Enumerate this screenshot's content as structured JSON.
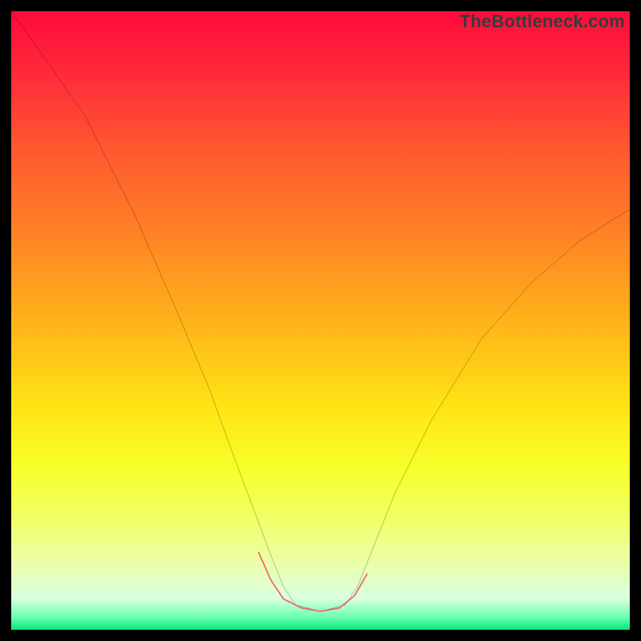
{
  "watermark_text": "TheBottleneck.com",
  "chart_data": {
    "type": "line",
    "title": "",
    "xlabel": "",
    "ylabel": "",
    "xlim": [
      0,
      100
    ],
    "ylim": [
      0,
      100
    ],
    "grid": false,
    "legend": false,
    "axes_visible": false,
    "background_gradient": {
      "direction": "top-to-bottom",
      "stops": [
        {
          "pos": 0,
          "color": "#ff0a3a"
        },
        {
          "pos": 10,
          "color": "#ff2a3a"
        },
        {
          "pos": 22,
          "color": "#ff5730"
        },
        {
          "pos": 36,
          "color": "#ff8225"
        },
        {
          "pos": 50,
          "color": "#ffb21a"
        },
        {
          "pos": 64,
          "color": "#ffe414"
        },
        {
          "pos": 74,
          "color": "#f7ff2a"
        },
        {
          "pos": 82,
          "color": "#f2ff66"
        },
        {
          "pos": 90,
          "color": "#e9ffb0"
        },
        {
          "pos": 95,
          "color": "#d8ffdf"
        },
        {
          "pos": 98,
          "color": "#6bffb0"
        },
        {
          "pos": 100,
          "color": "#00e87a"
        }
      ]
    },
    "series": [
      {
        "name": "bottleneck-curve",
        "color": "#000000",
        "width": 2,
        "x": [
          0,
          5,
          12,
          20,
          27,
          32,
          36,
          39,
          42,
          44,
          46,
          50,
          54,
          56,
          58,
          62,
          68,
          76,
          84,
          92,
          100
        ],
        "y": [
          100,
          93,
          83,
          67,
          51,
          39,
          28,
          20,
          12,
          7,
          4,
          3,
          4,
          7,
          12,
          22,
          34,
          47,
          56,
          63,
          68
        ]
      },
      {
        "name": "optimal-flat-segment",
        "color": "#ef6a72",
        "width": 14,
        "linecap": "round",
        "x": [
          40,
          42,
          44,
          47,
          50,
          53,
          55.5,
          57.5
        ],
        "y": [
          12.5,
          8,
          5,
          3.5,
          3,
          3.5,
          5.5,
          9
        ]
      }
    ]
  }
}
